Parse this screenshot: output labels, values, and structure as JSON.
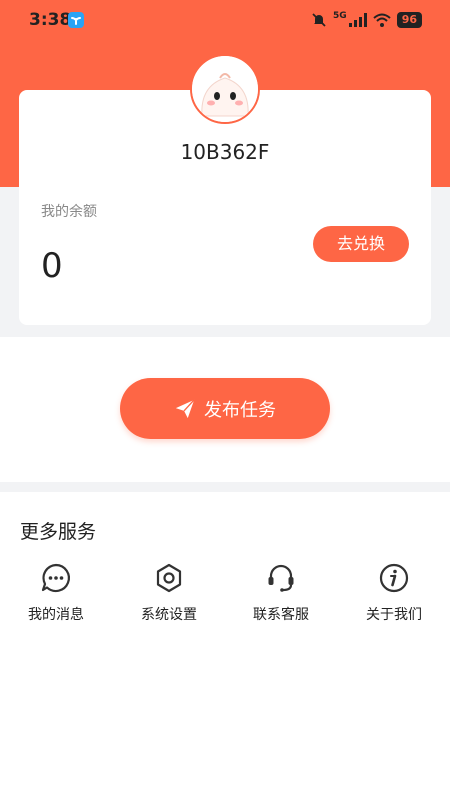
{
  "status_bar": {
    "time": "3:38",
    "network": "5G",
    "battery": "96"
  },
  "profile": {
    "user_id": "10B362F",
    "balance_label": "我的余额",
    "balance_value": "0",
    "exchange_label": "去兑换"
  },
  "publish": {
    "label": "发布任务",
    "icon": "paper-plane-icon"
  },
  "services": {
    "title": "更多服务",
    "items": [
      {
        "label": "我的消息",
        "icon": "chat-bubble-icon"
      },
      {
        "label": "系统设置",
        "icon": "hex-nut-settings-icon"
      },
      {
        "label": "联系客服",
        "icon": "headset-icon"
      },
      {
        "label": "关于我们",
        "icon": "info-icon"
      }
    ]
  },
  "colors": {
    "accent": "#fe6645",
    "background_gray": "#f2f3f5"
  }
}
